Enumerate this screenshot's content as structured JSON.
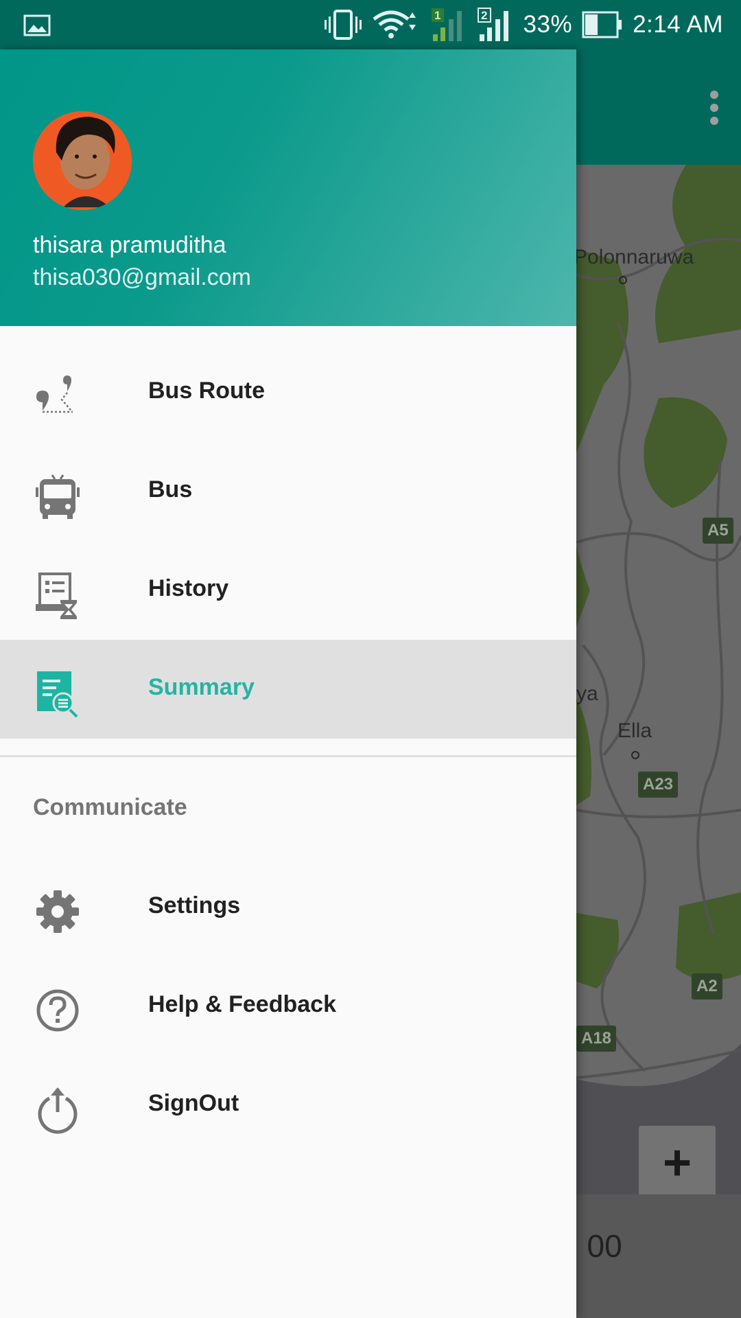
{
  "status_bar": {
    "battery": "33%",
    "time": "2:14 AM",
    "sim1": "1",
    "sim2": "2"
  },
  "map": {
    "labels": [
      "Polonnaruwa",
      "Ella",
      "ya"
    ],
    "roads": [
      "A5",
      "A23",
      "A2",
      "A18"
    ],
    "bottom_time": ": 00",
    "zoom_in": "+"
  },
  "drawer": {
    "user": {
      "name": "thisara pramuditha",
      "email": "thisa030@gmail.com"
    },
    "items": [
      {
        "label": "Bus Route",
        "icon": "bus-route-icon"
      },
      {
        "label": "Bus",
        "icon": "bus-icon"
      },
      {
        "label": "History",
        "icon": "history-icon"
      },
      {
        "label": "Summary",
        "icon": "summary-icon",
        "selected": true
      }
    ],
    "section_title": "Communicate",
    "secondary_items": [
      {
        "label": "Settings",
        "icon": "gear-icon"
      },
      {
        "label": "Help & Feedback",
        "icon": "help-icon"
      },
      {
        "label": "SignOut",
        "icon": "power-icon"
      }
    ]
  },
  "colors": {
    "primary_dark": "#00695c",
    "primary": "#009688",
    "accent": "#26b3a3",
    "selected_bg": "#e0e0e0"
  }
}
